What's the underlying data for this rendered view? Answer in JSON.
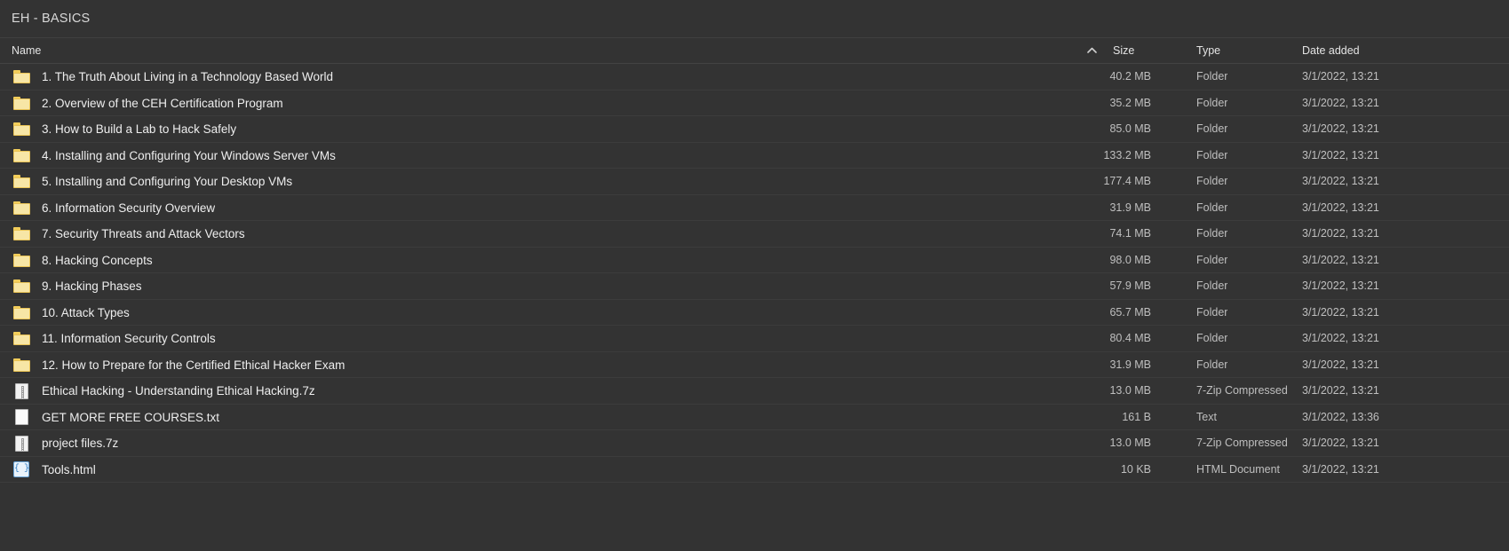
{
  "window": {
    "title": "EH - BASICS"
  },
  "columns": {
    "name": "Name",
    "size": "Size",
    "type": "Type",
    "date": "Date added",
    "sort_icon": "chevron-up-icon",
    "sorted_by": "name",
    "sort_direction": "ascending"
  },
  "colors": {
    "background": "#333333",
    "titlebar": "#333333",
    "row_border": "#3c3c3c",
    "text_primary": "#eeeeee",
    "text_secondary": "#bfbfbf",
    "folder_icon": "#f7e6a6",
    "html_icon_accent": "#2f7dc4"
  },
  "rows": [
    {
      "icon": "folder-icon",
      "name": "1. The Truth About Living in a Technology Based World",
      "size": "40.2 MB",
      "type": "Folder",
      "date": "3/1/2022, 13:21"
    },
    {
      "icon": "folder-icon",
      "name": "2. Overview of the CEH Certification Program",
      "size": "35.2 MB",
      "type": "Folder",
      "date": "3/1/2022, 13:21"
    },
    {
      "icon": "folder-icon",
      "name": "3. How to Build a Lab to Hack Safely",
      "size": "85.0 MB",
      "type": "Folder",
      "date": "3/1/2022, 13:21"
    },
    {
      "icon": "folder-icon",
      "name": "4. Installing and Configuring Your Windows Server VMs",
      "size": "133.2 MB",
      "type": "Folder",
      "date": "3/1/2022, 13:21"
    },
    {
      "icon": "folder-icon",
      "name": "5. Installing and Configuring Your Desktop VMs",
      "size": "177.4 MB",
      "type": "Folder",
      "date": "3/1/2022, 13:21"
    },
    {
      "icon": "folder-icon",
      "name": "6. Information Security Overview",
      "size": "31.9 MB",
      "type": "Folder",
      "date": "3/1/2022, 13:21"
    },
    {
      "icon": "folder-icon",
      "name": "7. Security Threats and Attack Vectors",
      "size": "74.1 MB",
      "type": "Folder",
      "date": "3/1/2022, 13:21"
    },
    {
      "icon": "folder-icon",
      "name": "8. Hacking Concepts",
      "size": "98.0 MB",
      "type": "Folder",
      "date": "3/1/2022, 13:21"
    },
    {
      "icon": "folder-icon",
      "name": "9. Hacking Phases",
      "size": "57.9 MB",
      "type": "Folder",
      "date": "3/1/2022, 13:21"
    },
    {
      "icon": "folder-icon",
      "name": "10. Attack Types",
      "size": "65.7 MB",
      "type": "Folder",
      "date": "3/1/2022, 13:21"
    },
    {
      "icon": "folder-icon",
      "name": "11. Information Security Controls",
      "size": "80.4 MB",
      "type": "Folder",
      "date": "3/1/2022, 13:21"
    },
    {
      "icon": "folder-icon",
      "name": "12. How to Prepare for the Certified Ethical Hacker Exam",
      "size": "31.9 MB",
      "type": "Folder",
      "date": "3/1/2022, 13:21"
    },
    {
      "icon": "archive-icon",
      "name": "Ethical Hacking - Understanding Ethical Hacking.7z",
      "size": "13.0 MB",
      "type": "7-Zip Compressed",
      "date": "3/1/2022, 13:21"
    },
    {
      "icon": "text-file-icon",
      "name": "GET MORE FREE COURSES.txt",
      "size": "161 B",
      "type": "Text",
      "date": "3/1/2022, 13:36"
    },
    {
      "icon": "archive-icon",
      "name": "project files.7z",
      "size": "13.0 MB",
      "type": "7-Zip Compressed",
      "date": "3/1/2022, 13:21"
    },
    {
      "icon": "html-file-icon",
      "name": "Tools.html",
      "size": "10 KB",
      "type": "HTML Document",
      "date": "3/1/2022, 13:21"
    }
  ]
}
